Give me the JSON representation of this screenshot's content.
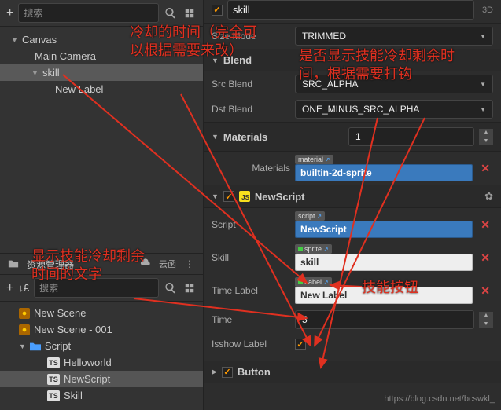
{
  "search_placeholder": "搜索",
  "hierarchy": {
    "canvas": "Canvas",
    "main_camera": "Main Camera",
    "skill": "skill",
    "new_label": "New Label"
  },
  "asset_panel": {
    "title": "资源管理器",
    "cloud": "云函",
    "search_placeholder": "搜索",
    "new_scene": "New Scene",
    "new_scene_001": "New Scene - 001",
    "script_folder": "Script",
    "helloworld": "Helloworld",
    "newscript": "NewScript",
    "skill": "Skill",
    "ts_badge": "TS"
  },
  "inspector": {
    "node_name": "skill",
    "badge_3d": "3D",
    "size_mode_label": "Size Mode",
    "size_mode_value": "TRIMMED",
    "blend_section": "Blend",
    "src_blend_label": "Src Blend",
    "src_blend_value": "SRC_ALPHA",
    "dst_blend_label": "Dst Blend",
    "dst_blend_value": "ONE_MINUS_SRC_ALPHA",
    "materials_section": "Materials",
    "materials_count": "1",
    "materials_label": "Materials",
    "material_tag": "material",
    "material_value": "builtin-2d-sprite",
    "newscript_section": "NewScript",
    "script_label": "Script",
    "script_tag": "script",
    "script_value": "NewScript",
    "skill_label": "Skill",
    "sprite_tag": "sprite",
    "skill_value": "skill",
    "time_label_label": "Time Label",
    "label_tag": "Label",
    "time_label_value": "New Label",
    "time_label": "Time",
    "time_value": "5",
    "isshow_label": "Isshow Label",
    "button_section": "Button",
    "ext_icon": "↗"
  },
  "annotations": {
    "a1": "冷却的时间（完全可以根据需要来改）",
    "a2": "是否显示技能冷却剩余时间，根据需要打钩",
    "a3": "显示技能冷却剩余时间的文字",
    "a4": "技能按钮"
  },
  "watermark": "https://blog.csdn.net/bcswkl_"
}
